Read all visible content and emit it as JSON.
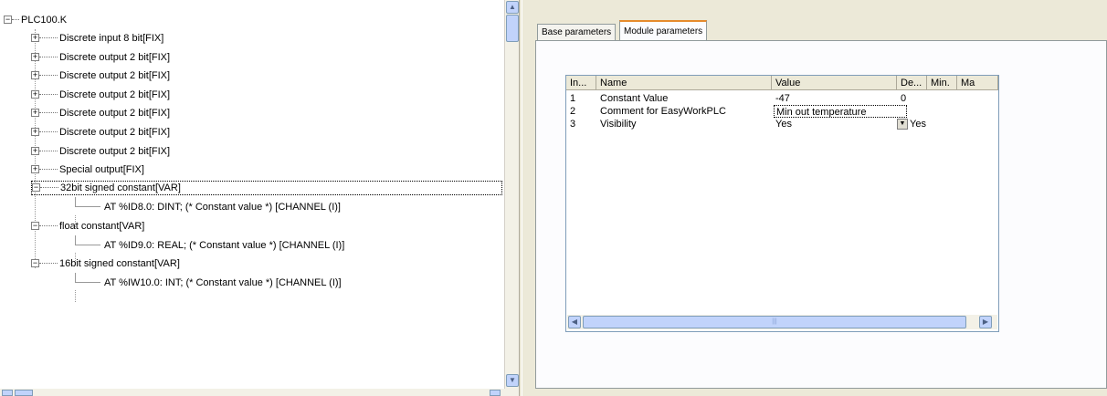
{
  "tree": {
    "root": "PLC100.K",
    "items": [
      {
        "label": "Discrete input 8 bit[FIX]",
        "expander": "+"
      },
      {
        "label": "Discrete output 2 bit[FIX]",
        "expander": "+"
      },
      {
        "label": "Discrete output 2 bit[FIX]",
        "expander": "+"
      },
      {
        "label": "Discrete output 2 bit[FIX]",
        "expander": "+"
      },
      {
        "label": "Discrete output 2 bit[FIX]",
        "expander": "+"
      },
      {
        "label": "Discrete output 2 bit[FIX]",
        "expander": "+"
      },
      {
        "label": "Discrete output 2 bit[FIX]",
        "expander": "+"
      },
      {
        "label": "Special output[FIX]",
        "expander": "+"
      },
      {
        "label": "32bit signed constant[VAR]",
        "expander": "−"
      },
      {
        "label": "AT %ID8.0: DINT; (* Constant value *) [CHANNEL (I)]",
        "expander": ""
      },
      {
        "label": "float constant[VAR]",
        "expander": "−"
      },
      {
        "label": "AT %ID9.0: REAL; (* Constant value *) [CHANNEL (I)]",
        "expander": ""
      },
      {
        "label": "16bit signed constant[VAR]",
        "expander": "−"
      },
      {
        "label": "AT %IW10.0: INT; (* Constant value *) [CHANNEL (I)]",
        "expander": ""
      }
    ]
  },
  "tabs": {
    "base": "Base parameters",
    "module": "Module parameters"
  },
  "grid": {
    "columns": [
      "In...",
      "Name",
      "Value",
      "De...",
      "Min.",
      "Ma"
    ],
    "rows": [
      {
        "index": "1",
        "name": "Constant Value",
        "value": "-47",
        "default": "0"
      },
      {
        "index": "2",
        "name": "Comment for EasyWorkPLC",
        "value": "Min out temperature",
        "default": ""
      },
      {
        "index": "3",
        "name": "Visibility",
        "value": "Yes",
        "default": "Yes"
      }
    ],
    "scroll_mid": "|||"
  },
  "icons": {
    "expand": "plus-box-icon",
    "collapse": "minus-box-icon",
    "scroll_up": "arrow-up-icon",
    "scroll_down": "arrow-down-icon",
    "scroll_left": "arrow-left-icon",
    "scroll_right": "arrow-right-icon",
    "combo": "dropdown-arrow-icon"
  },
  "colors": {
    "window_bg": "#ece9d8",
    "tab_accent": "#e68b2c",
    "scroll_blue": "#c1d3fb"
  }
}
